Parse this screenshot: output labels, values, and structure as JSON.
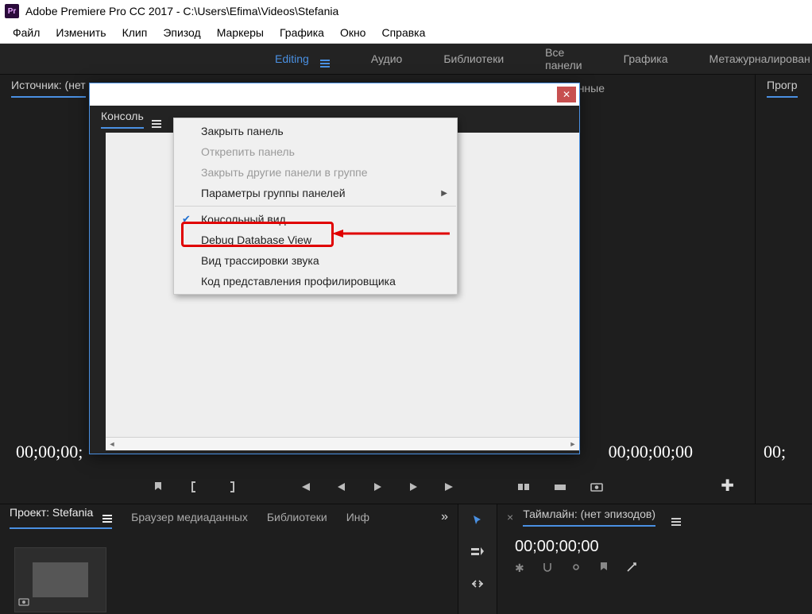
{
  "titlebar": {
    "app_icon_text": "Pr",
    "title": "Adobe Premiere Pro CC 2017 - C:\\Users\\Efima\\Videos\\Stefania"
  },
  "menubar": [
    "Файл",
    "Изменить",
    "Клип",
    "Эпизод",
    "Маркеры",
    "Графика",
    "Окно",
    "Справка"
  ],
  "workspaces": {
    "items": [
      "Editing",
      "Аудио",
      "Библиотеки",
      "Все панели",
      "Графика",
      "Метажурналирован"
    ],
    "active_index": 0
  },
  "source_panel": {
    "tab_label": "Источник: (нет",
    "tc_left": "00;00;00;",
    "tc_right": "00;00;00;00",
    "hidden_tab_fragment": "нные"
  },
  "program_panel": {
    "tab_label": "Прогр",
    "tc": "00;"
  },
  "project_panel": {
    "tabs": [
      "Проект: Stefania",
      "Браузер медиаданных",
      "Библиотеки",
      "Инф"
    ],
    "active_index": 0
  },
  "timeline_panel": {
    "tab_label": "Таймлайн: (нет эпизодов)",
    "tc": "00;00;00;00"
  },
  "console_window": {
    "panel_label": "Консоль"
  },
  "context_menu": {
    "items": [
      {
        "label": "Закрыть панель",
        "enabled": true
      },
      {
        "label": "Открепить панель",
        "enabled": false
      },
      {
        "label": "Закрыть другие панели в группе",
        "enabled": false
      },
      {
        "label": "Параметры группы панелей",
        "enabled": true,
        "submenu": true
      },
      {
        "sep": true
      },
      {
        "label": "Консольный вид",
        "enabled": true,
        "checked": true
      },
      {
        "label": "Debug Database View",
        "enabled": true,
        "highlight": true
      },
      {
        "label": "Вид трассировки звука",
        "enabled": true
      },
      {
        "label": "Код представления профилировщика",
        "enabled": true
      }
    ]
  }
}
